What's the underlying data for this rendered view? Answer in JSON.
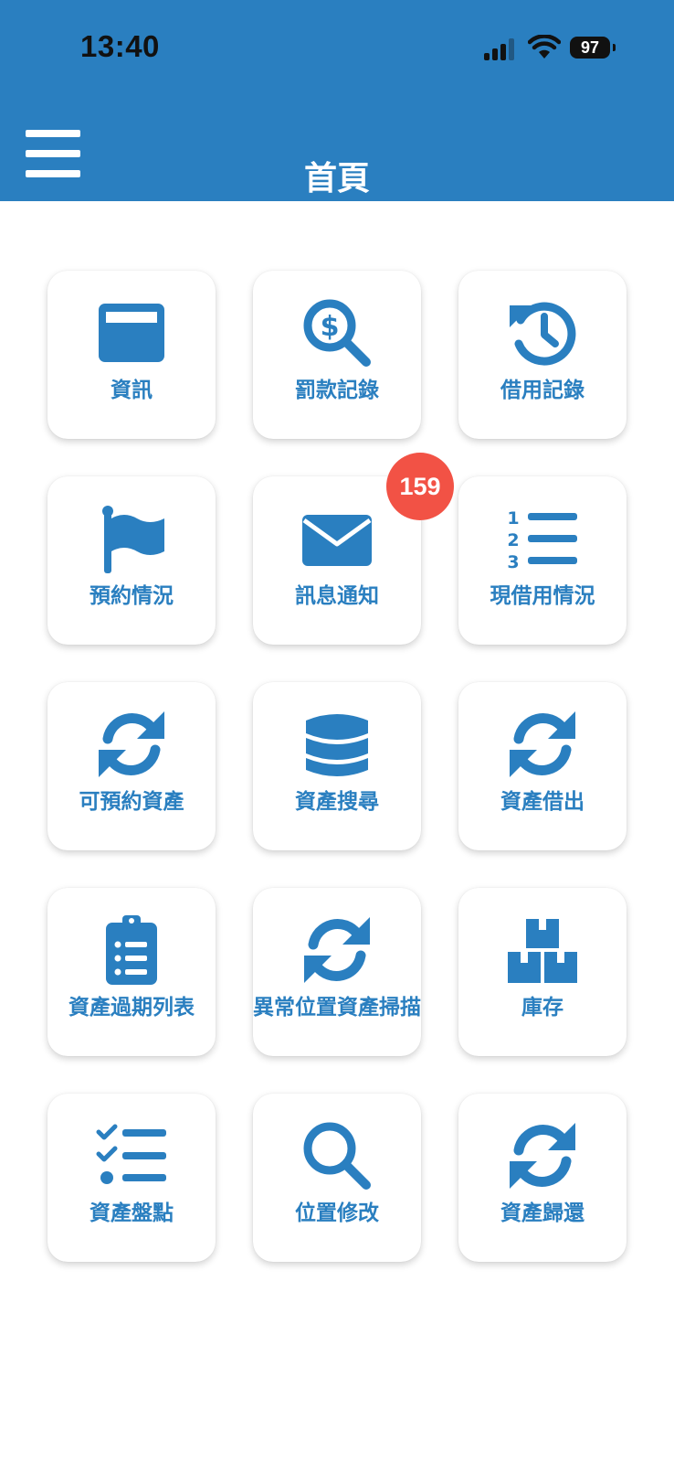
{
  "status_bar": {
    "time": "13:40",
    "battery": "97"
  },
  "header": {
    "title": "首頁"
  },
  "tiles": [
    {
      "label": "資訊",
      "icon": "credit-card-icon"
    },
    {
      "label": "罰款記錄",
      "icon": "search-dollar-icon"
    },
    {
      "label": "借用記錄",
      "icon": "history-icon"
    },
    {
      "label": "預約情況",
      "icon": "flag-icon"
    },
    {
      "label": "訊息通知",
      "icon": "envelope-icon",
      "badge": "159"
    },
    {
      "label": "現借用情況",
      "icon": "numbered-list-icon"
    },
    {
      "label": "可預約資產",
      "icon": "sync-icon"
    },
    {
      "label": "資產搜尋",
      "icon": "database-icon"
    },
    {
      "label": "資產借出",
      "icon": "sync-icon"
    },
    {
      "label": "資產過期列表",
      "icon": "clipboard-list-icon"
    },
    {
      "label": "異常位置資產掃描",
      "icon": "sync-icon"
    },
    {
      "label": "庫存",
      "icon": "boxes-icon"
    },
    {
      "label": "資產盤點",
      "icon": "tasks-icon"
    },
    {
      "label": "位置修改",
      "icon": "search-icon"
    },
    {
      "label": "資產歸還",
      "icon": "sync-icon"
    }
  ],
  "colors": {
    "primary": "#2a7fc0",
    "badge": "#f25245",
    "background": "#ffffff"
  }
}
